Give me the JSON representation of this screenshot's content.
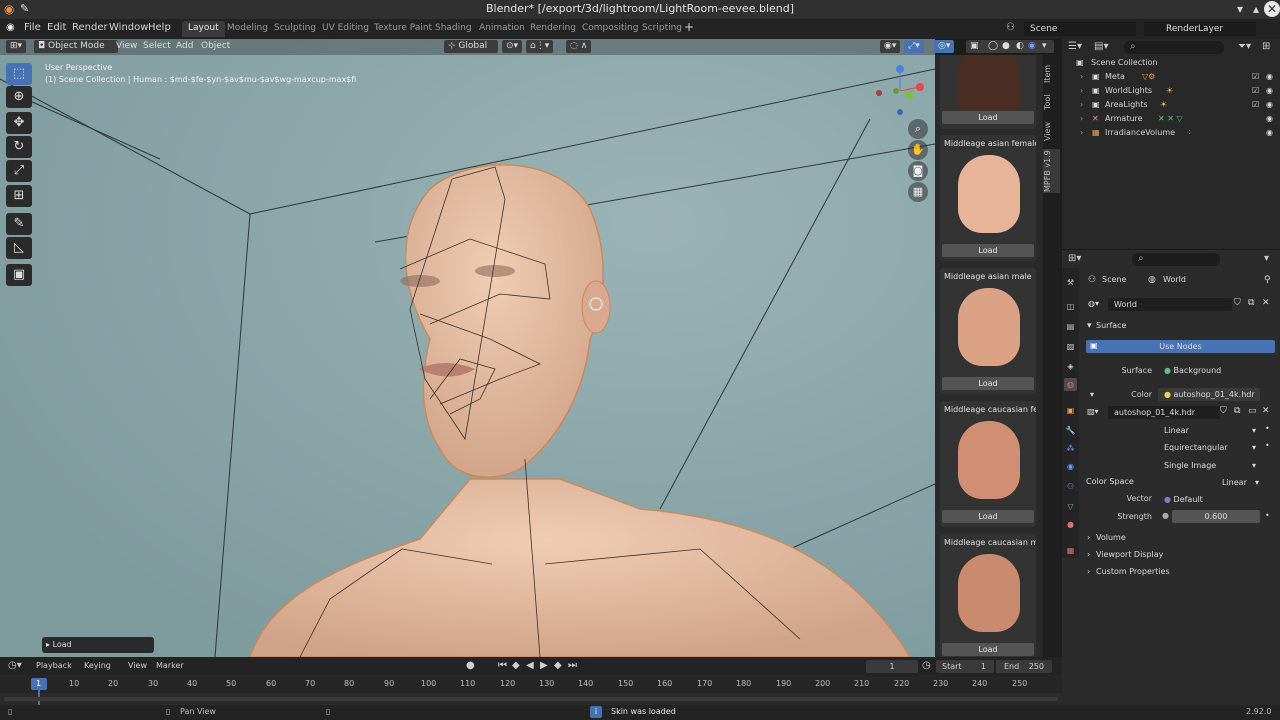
{
  "window": {
    "title": "Blender* [/export/3d/lightroom/LightRoom-eevee.blend]"
  },
  "menu": [
    "File",
    "Edit",
    "Render",
    "Window",
    "Help"
  ],
  "workspaces": [
    "Layout",
    "Modeling",
    "Sculpting",
    "UV Editing",
    "Texture Paint",
    "Shading",
    "Animation",
    "Rendering",
    "Compositing",
    "Scripting"
  ],
  "active_workspace": "Layout",
  "scene": {
    "label": "Scene",
    "render_layer": "RenderLayer"
  },
  "viewport": {
    "mode": "Object Mode",
    "menus": [
      "View",
      "Select",
      "Add",
      "Object"
    ],
    "transform_orientation": "Global",
    "view_name": "User Perspective",
    "collection_info": "(1) Scene Collection | Human : $md-$fe-$yn-$av$mu-$av$wg-maxcup-max$fi",
    "last_op": "Load"
  },
  "skins": [
    {
      "label": "",
      "load": "Load"
    },
    {
      "label": "Middleage asian female",
      "load": "Load"
    },
    {
      "label": "Middleage asian male",
      "load": "Load"
    },
    {
      "label": "Middleage caucasian fe...",
      "load": "Load"
    },
    {
      "label": "Middleage caucasian m...",
      "load": "Load"
    }
  ],
  "side_tabs": [
    "Item",
    "Tool",
    "View",
    "MPFB v1.9"
  ],
  "outliner": {
    "root": "Scene Collection",
    "items": [
      "Meta",
      "WorldLights",
      "AreaLights",
      "Armature",
      "IrradianceVolume"
    ]
  },
  "properties": {
    "context": [
      "Scene",
      "World"
    ],
    "world_name": "World",
    "surface_section": "Surface",
    "use_nodes": "Use Nodes",
    "rows": {
      "surface_label": "Surface",
      "surface_value": "Background",
      "color_label": "Color",
      "color_value": "autoshop_01_4k.hdr",
      "image_name": "autoshop_01_4k.hdr",
      "interp": "Linear",
      "projection": "Equirectangular",
      "source": "Single Image",
      "colorspace_label": "Color Space",
      "colorspace_value": "Linear",
      "vector_label": "Vector",
      "vector_value": "Default",
      "strength_label": "Strength",
      "strength_value": "0.600"
    },
    "sections": [
      "Volume",
      "Viewport Display",
      "Custom Properties"
    ]
  },
  "timeline": {
    "menus": [
      "Playback",
      "Keying",
      "View",
      "Marker"
    ],
    "current_frame": "1",
    "start_label": "Start",
    "start": "1",
    "end_label": "End",
    "end": "250",
    "ticks": [
      "1",
      "10",
      "20",
      "30",
      "40",
      "50",
      "60",
      "70",
      "80",
      "90",
      "100",
      "110",
      "120",
      "130",
      "140",
      "150",
      "160",
      "170",
      "180",
      "190",
      "200",
      "210",
      "220",
      "230",
      "240",
      "250"
    ]
  },
  "status": {
    "left": "Pan View",
    "message": "Skin was loaded",
    "version": "2.92.0"
  },
  "colors": {
    "accent": "#4772b3",
    "viewport_bg": "#839ea1",
    "skin": "#e4b89a"
  }
}
